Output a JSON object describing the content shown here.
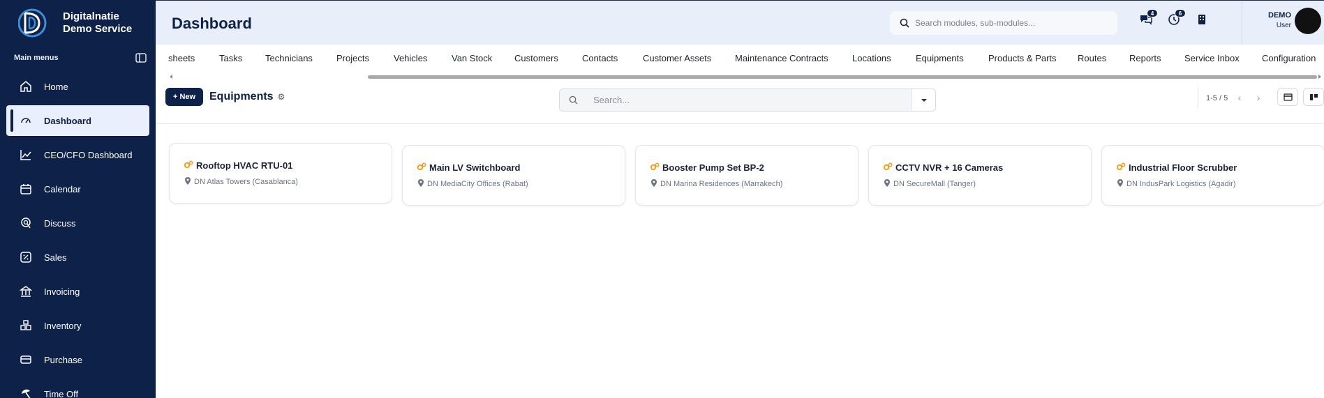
{
  "brand": {
    "line1": "Digitalnatie",
    "line2": "Demo Service"
  },
  "sidebar": {
    "header": "Main menus",
    "items": [
      {
        "label": "Home",
        "icon": "home-icon",
        "active": false
      },
      {
        "label": "Dashboard",
        "icon": "gauge-icon",
        "active": true
      },
      {
        "label": "CEO/CFO Dashboard",
        "icon": "line-chart-icon",
        "active": false
      },
      {
        "label": "Calendar",
        "icon": "calendar-icon",
        "active": false
      },
      {
        "label": "Discuss",
        "icon": "chat-icon",
        "active": false
      },
      {
        "label": "Sales",
        "icon": "percent-icon",
        "active": false
      },
      {
        "label": "Invoicing",
        "icon": "bank-icon",
        "active": false
      },
      {
        "label": "Inventory",
        "icon": "boxes-icon",
        "active": false
      },
      {
        "label": "Purchase",
        "icon": "card-icon",
        "active": false
      },
      {
        "label": "Time Off",
        "icon": "umbrella-icon",
        "active": false
      }
    ]
  },
  "header": {
    "title": "Dashboard",
    "search_placeholder": "Search modules, sub-modules...",
    "chat_badge": "4",
    "activity_badge": "6",
    "user_name": "DEMO",
    "user_role": "User"
  },
  "tabs": [
    "sheets",
    "Tasks",
    "Technicians",
    "Projects",
    "Vehicles",
    "Van Stock",
    "Customers",
    "Contacts",
    "Customer Assets",
    "Maintenance Contracts",
    "Locations",
    "Equipments",
    "Products & Parts",
    "Routes",
    "Reports",
    "Service Inbox",
    "Configuration"
  ],
  "toolbar": {
    "new_label": "+ New",
    "view_title": "Equipments",
    "search_placeholder": "Search...",
    "pager": "1-5 / 5"
  },
  "cards": [
    {
      "title": "Rooftop HVAC RTU-01",
      "location": "DN Atlas Towers (Casablanca)"
    },
    {
      "title": "Main LV Switchboard",
      "location": "DN MediaCity Offices (Rabat)"
    },
    {
      "title": "Booster Pump Set BP-2",
      "location": "DN Marina Residences (Marrakech)"
    },
    {
      "title": "CCTV NVR + 16 Cameras",
      "location": "DN SecureMall (Tanger)"
    },
    {
      "title": "Industrial Floor Scrubber",
      "location": "DN IndusPark Logistics (Agadir)"
    }
  ],
  "colors": {
    "sidebar_bg": "#0d2149",
    "accent": "#0d2149",
    "equip_icon": "#f0a21f",
    "header_bg": "#e9effa"
  }
}
